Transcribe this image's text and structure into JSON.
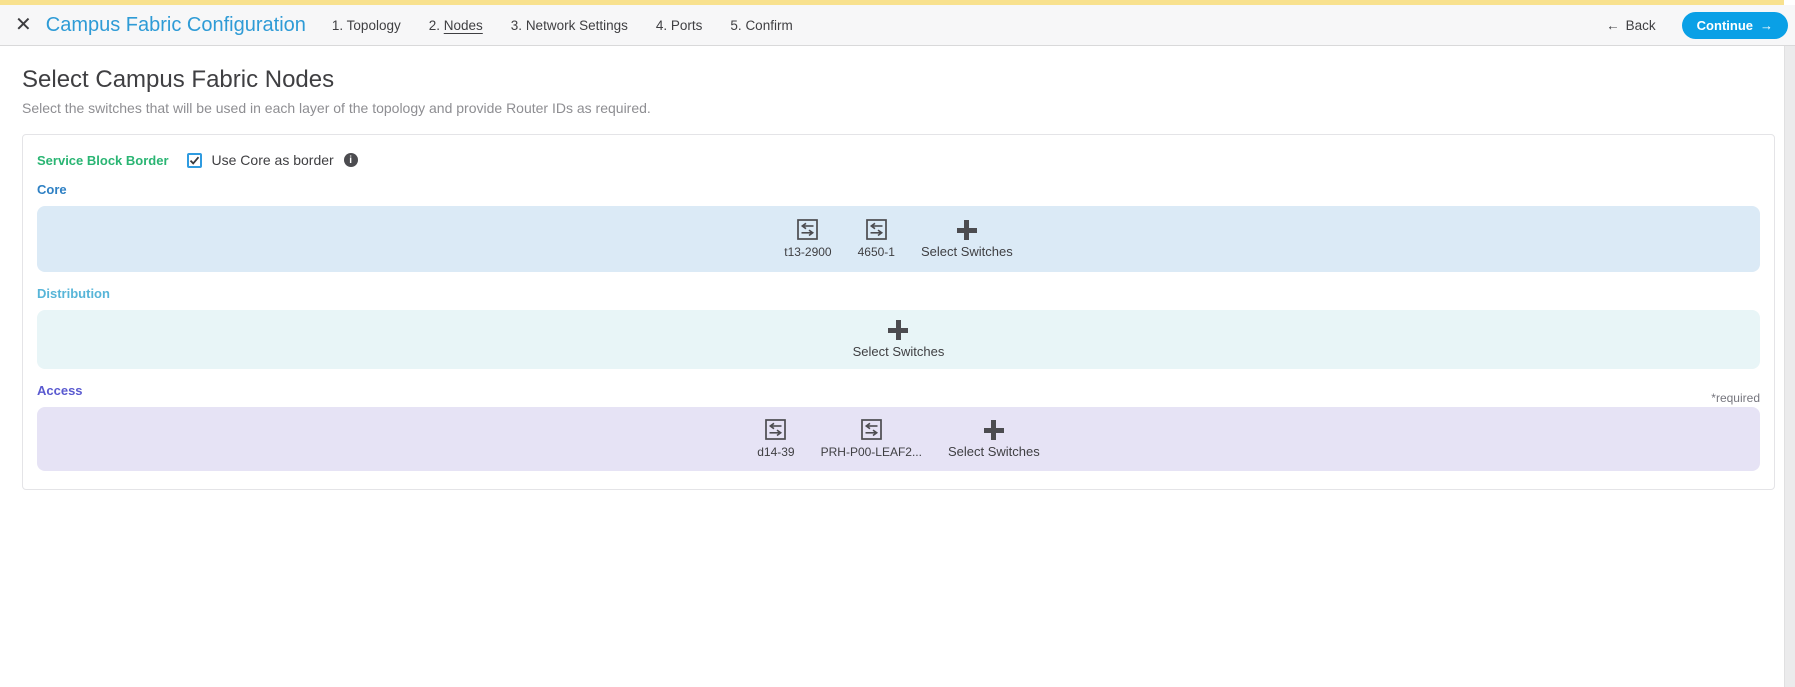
{
  "header": {
    "close_icon": "✕",
    "title": "Campus Fabric Configuration",
    "steps": [
      {
        "prefix": "1.",
        "label": "Topology"
      },
      {
        "prefix": "2.",
        "label": "Nodes"
      },
      {
        "prefix": "3.",
        "label": "Network Settings"
      },
      {
        "prefix": "4.",
        "label": "Ports"
      },
      {
        "prefix": "5.",
        "label": "Confirm"
      }
    ],
    "active_step": "2. Nodes",
    "back": {
      "arrow": "←",
      "label": "Back"
    },
    "continue": {
      "label": "Continue",
      "arrow": "→"
    }
  },
  "page": {
    "title": "Select Campus Fabric Nodes",
    "subtitle": "Select the switches that will be used in each layer of the topology and provide Router IDs as required."
  },
  "service_block": {
    "label": "Service Block Border",
    "checkbox_label": "Use Core as border",
    "checkbox_checked": true,
    "info_icon": "i"
  },
  "layers": {
    "core": {
      "label": "Core",
      "switches": [
        "t13-2900",
        "4650-1"
      ],
      "select_label": "Select Switches"
    },
    "distribution": {
      "label": "Distribution",
      "switches": [],
      "select_label": "Select Switches"
    },
    "access": {
      "label": "Access",
      "required_note": "*required",
      "switches": [
        "d14-39",
        "PRH-P00-LEAF2..."
      ],
      "select_label": "Select Switches"
    }
  },
  "colors": {
    "accent_bar": "#f8e18e",
    "title_blue": "#2e9bd6",
    "continue_button": "#0aa0e6",
    "service_green": "#2ab573",
    "core_label": "#2e80c4",
    "distribution_label": "#57b5d8",
    "access_label": "#5a5ad0",
    "core_band": "#dbeaf6",
    "distribution_band": "#e8f5f7",
    "access_band": "#e6e3f5"
  }
}
